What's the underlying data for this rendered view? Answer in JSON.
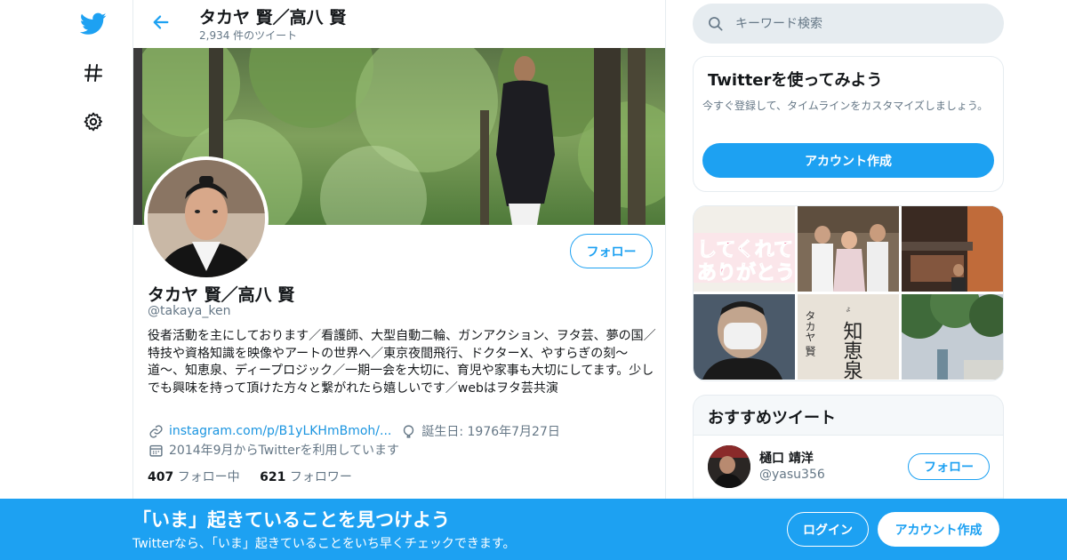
{
  "nav": {
    "icons": [
      "twitter-bird-icon",
      "hashtag-icon",
      "gear-icon"
    ]
  },
  "header": {
    "name": "タカヤ 賢／高八 賢",
    "tweet_count": "2,934 件のツイート"
  },
  "profile": {
    "name": "タカヤ 賢／高八 賢",
    "handle": "@takaya_ken",
    "follow_label": "フォロー",
    "bio": "役者活動を主にしております／看護師、大型自動二輪、ガンアクション、ヲタ芸、夢の国／特技や資格知識を映像やアートの世界へ／東京夜間飛行、ドクターX、やすらぎの刻〜道〜、知恵泉、ディープロジック／一期一会を大切に、育児や家事も大切にしてます。少しでも興味を持って頂けた方々と繋がれたら嬉しいです／webはヲタ芸共演",
    "link": "instagram.com/p/B1yLKHmBmoh/...",
    "birthday": "誕生日: 1976年7月27日",
    "joined": "2014年9月からTwitterを利用しています",
    "following_count": "407",
    "following_label": "フォロー中",
    "followers_count": "621",
    "followers_label": "フォロワー"
  },
  "search": {
    "placeholder": "キーワード検索"
  },
  "signup_card": {
    "title": "Twitterを使ってみよう",
    "text": "今すぐ登録して、タイムラインをカスタマイズしましょう。",
    "button": "アカウント作成"
  },
  "media": {
    "caption_text": "してくれてありがとう",
    "sign_text": "タカヤ 賢"
  },
  "recommended": {
    "title": "おすすめツイート",
    "user_name": "樋口 靖洋",
    "user_handle": "@yasu356",
    "follow_label": "フォロー"
  },
  "bottom_bar": {
    "title": "「いま」起きていることを見つけよう",
    "subtitle": "Twitterなら、「いま」起きていることをいち早くチェックできます。",
    "login": "ログイン",
    "signup": "アカウント作成"
  },
  "colors": {
    "accent": "#1da1f2",
    "link": "#1b95e0",
    "secondary_text": "#657786",
    "border": "#e6ecf0"
  }
}
